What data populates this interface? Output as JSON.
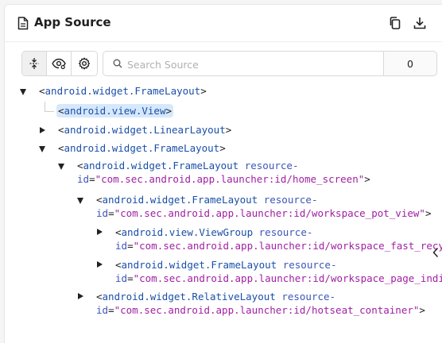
{
  "header": {
    "title": "App Source",
    "title_icon": "file-text-icon",
    "actions": [
      "copy-icon",
      "download-icon"
    ]
  },
  "toolbar": {
    "buttons": [
      "expand-collapse-icon",
      "eye-icon",
      "gear-icon"
    ],
    "search_placeholder": "Search Source",
    "search_value": "",
    "match_count": "0"
  },
  "tree": [
    {
      "open": "<",
      "tag": "android.widget.FrameLayout",
      "close": ">"
    },
    {
      "open": "<",
      "tag": "android.view.View",
      "close": ">"
    },
    {
      "open": "<",
      "tag": "android.widget.LinearLayout",
      "close": ">"
    },
    {
      "open": "<",
      "tag": "android.widget.FrameLayout",
      "close": ">"
    },
    {
      "open": "<",
      "tag": "android.widget.FrameLayout",
      "attr_a": "resource-",
      "attr_b": "id",
      "eq": "=",
      "value": "\"com.sec.android.app.launcher:id/home_screen\"",
      "close": ">"
    },
    {
      "open": "<",
      "tag": "android.widget.FrameLayout",
      "attr_a": "resource-",
      "attr_b": "id",
      "eq": "=",
      "value": "\"com.sec.android.app.launcher:id/workspace_pot_view\"",
      "close": ">"
    },
    {
      "open": "<",
      "tag": "android.view.ViewGroup",
      "attr_a": "resource-",
      "attr_b": "id",
      "eq": "=",
      "value": "\"com.sec.android.app.launcher:id/workspace_fast_recy",
      "close": ""
    },
    {
      "open": "<",
      "tag": "android.widget.FrameLayout",
      "attr_a": "resource-",
      "attr_b": "id",
      "eq": "=",
      "value": "\"com.sec.android.app.launcher:id/workspace_page_indi",
      "close": ""
    },
    {
      "open": "<",
      "tag": "android.widget.RelativeLayout",
      "attr_a": "resource-",
      "attr_b": "id",
      "eq": "=",
      "value": "\"com.sec.android.app.launcher:id/hotseat_container\"",
      "close": ">"
    }
  ],
  "colors": {
    "tag": "#1a4fa8",
    "attribute": "#3c56b8",
    "value": "#a01fa3",
    "selected_bg": "#d6e8fb"
  }
}
